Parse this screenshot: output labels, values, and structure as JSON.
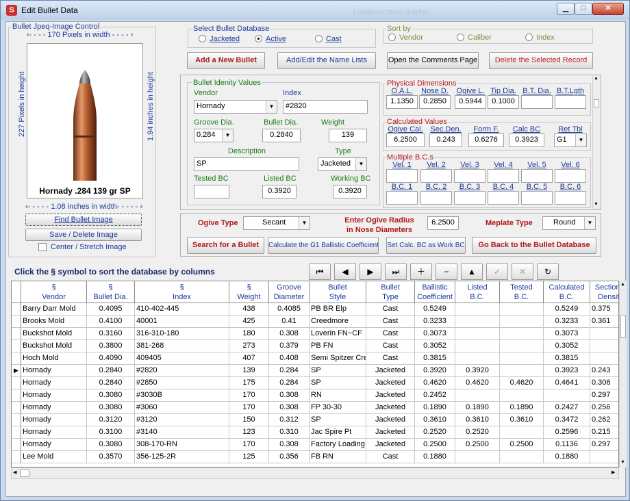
{
  "window": {
    "title": "Edit Bullet Data",
    "ghost_title": "Loadbenchtrial.graphic",
    "minimize": "▁",
    "maximize": "□",
    "close": "✕"
  },
  "image_control": {
    "group_label": "Bullet Jpeq-Image Control",
    "width_pixels": "‹- - - -  170  Pixels in width - - - - ›",
    "height_pixels": "227 Pixels in height",
    "height_inches": "1.94 inches in height",
    "width_inches": "‹- - - - - 1.08 inches in width- - - - - ›",
    "caption": "Hornady .284 139 gr SP",
    "find_button": "Find Bullet Image",
    "save_button": "Save / Delete Image",
    "center_label": "Center / Stretch Image"
  },
  "select_db": {
    "label": "Select Bullet Database",
    "options": [
      "Jacketed",
      "Active",
      "Cast"
    ],
    "selected": "Active"
  },
  "sort_by": {
    "label": "Sort by",
    "options": [
      "Vendor",
      "Caliber",
      "Index"
    ]
  },
  "buttons": {
    "add_new": "Add a New Bullet",
    "add_edit_names": "Add/Edit the Name Lists",
    "open_comments": "Open the Comments Page",
    "delete_record": "Delete the Selected Record",
    "search": "Search for a Bullet",
    "calc_g1": "Calculate the G1 Ballistic Coefficient",
    "set_calc_bc": "Set Calc. BC as Work BC",
    "go_back": "Go Back to the Bullet Database"
  },
  "identity": {
    "label": "Bullet Idenity Values",
    "vendor_label": "Vendor",
    "vendor": "Hornady",
    "index_label": "Index",
    "index": "#2820",
    "groove_label": "Groove Dia.",
    "groove": "0.284",
    "bullet_dia_label": "Bullet Dia.",
    "bullet_dia": "0.2840",
    "weight_label": "Weight",
    "weight": "139",
    "description_label": "Description",
    "description": "SP",
    "type_label": "Type",
    "type": "Jacketed",
    "tested_bc_label": "Tested BC",
    "tested_bc": "",
    "listed_bc_label": "Listed BC",
    "listed_bc": "0.3920",
    "working_bc_label": "Working BC",
    "working_bc": "0.3920"
  },
  "physical": {
    "label": "Physical Dimensions",
    "headers": [
      "O.A.L.",
      "Nose D.",
      "Ogive L.",
      "Tip Dia.",
      "B.T. Dia.",
      "B.T.Lgth"
    ],
    "values": [
      "1.1350",
      "0.2850",
      "0.5944",
      "0.1000",
      "",
      ""
    ]
  },
  "calculated": {
    "label": "Calculated Values",
    "headers": [
      "Ogive Cal.",
      "Sec.Den.",
      "Form F.",
      "Calc BC",
      "Ret Tbl"
    ],
    "values": [
      "6.2500",
      "0.243",
      "0.6276",
      "0.3923",
      "G1"
    ]
  },
  "multiple_bcs": {
    "label": "Multiple B.C.s",
    "vel_headers": [
      "Vel. 1",
      "Vel. 2",
      "Vel. 3",
      "Vel. 4",
      "Vel. 5",
      "Vel. 6"
    ],
    "bc_headers": [
      "B.C. 1",
      "B.C. 2",
      "B.C. 3",
      "B.C. 4",
      "B.C. 5",
      "B.C. 6"
    ]
  },
  "ogive": {
    "ogive_type_label": "Ogive Type",
    "ogive_type": "Secant",
    "radius_label1": "Enter Ogive Radius",
    "radius_label2": "in Nose Diameters",
    "radius": "6.2500",
    "meplate_label": "Meplate Type",
    "meplate": "Round"
  },
  "sort_hint": "Click the  §  symbol to sort the database by  columns",
  "navigator": [
    "⏮",
    "◀",
    "▶",
    "⏭",
    "＋",
    "−",
    "▲",
    "✓",
    "✕",
    "↻"
  ],
  "grid": {
    "columns": [
      {
        "sym": "§",
        "label": "Vendor"
      },
      {
        "sym": "§",
        "label": "Bullet Dia."
      },
      {
        "sym": "§",
        "label": "Index"
      },
      {
        "sym": "§",
        "label": "Weight"
      },
      {
        "sym": "Groove",
        "label": "Diameter"
      },
      {
        "sym": "Bullet",
        "label": "Style"
      },
      {
        "sym": "Bullet",
        "label": "Type"
      },
      {
        "sym": "Ballistic",
        "label": "Coefficient"
      },
      {
        "sym": "Listed",
        "label": "B.C."
      },
      {
        "sym": "Tested",
        "label": "B.C."
      },
      {
        "sym": "Calculated",
        "label": "B.C."
      },
      {
        "sym": "Sectional",
        "label": "Density"
      }
    ],
    "current_row": 5,
    "rows": [
      [
        "Barry Darr Mold",
        "0.4095",
        "410-402-445",
        "438",
        "0.4085",
        "PB BR Elp",
        "Cast",
        "0.5249",
        "",
        "",
        "0.5249",
        "0.375"
      ],
      [
        "Brooks Mold",
        "0.4100",
        "40001",
        "425",
        "0.41",
        "Creedmore",
        "Cast",
        "0.3233",
        "",
        "",
        "0.3233",
        "0.361"
      ],
      [
        "Buckshot Mold",
        "0.3160",
        "316-310-180",
        "180",
        "0.308",
        "Loverin FN~CF",
        "Cast",
        "0.3073",
        "",
        "",
        "0.3073",
        ""
      ],
      [
        "Buckshot Mold",
        "0.3800",
        "381-268",
        "273",
        "0.379",
        "PB FN",
        "Cast",
        "0.3052",
        "",
        "",
        "0.3052",
        ""
      ],
      [
        "Hoch Mold",
        "0.4090",
        "409405",
        "407",
        "0.408",
        "Semi Spitzer Cre",
        "Cast",
        "0.3815",
        "",
        "",
        "0.3815",
        ""
      ],
      [
        "Hornady",
        "0.2840",
        "#2820",
        "139",
        "0.284",
        "SP",
        "Jacketed",
        "0.3920",
        "0.3920",
        "",
        "0.3923",
        "0.243"
      ],
      [
        "Hornady",
        "0.2840",
        "#2850",
        "175",
        "0.284",
        "SP",
        "Jacketed",
        "0.4620",
        "0.4620",
        "0.4620",
        "0.4641",
        "0.306"
      ],
      [
        "Hornady",
        "0.3080",
        "#3030B",
        "170",
        "0.308",
        "RN",
        "Jacketed",
        "0.2452",
        "",
        "",
        "",
        "0.297"
      ],
      [
        "Hornady",
        "0.3080",
        "#3060",
        "170",
        "0.308",
        "FP 30-30",
        "Jacketed",
        "0.1890",
        "0.1890",
        "0.1890",
        "0.2427",
        "0.256"
      ],
      [
        "Hornady",
        "0.3120",
        "#3120",
        "150",
        "0.312",
        "SP",
        "Jacketed",
        "0.3610",
        "0.3610",
        "0.3610",
        "0.3472",
        "0.262"
      ],
      [
        "Hornady",
        "0.3100",
        "#3140",
        "123",
        "0.310",
        "Jac Spire Pt",
        "Jacketed",
        "0.2520",
        "0.2520",
        "",
        "0.2596",
        "0.215"
      ],
      [
        "Hornady",
        "0.3080",
        "308-170-RN",
        "170",
        "0.308",
        "Factory Loading",
        "Jacketed",
        "0.2500",
        "0.2500",
        "0.2500",
        "0.1136",
        "0.297"
      ],
      [
        "Lee Mold",
        "0.3570",
        "356-125-2R",
        "125",
        "0.356",
        "FB RN",
        "Cast",
        "0.1880",
        "",
        "",
        "0.1880",
        ""
      ]
    ]
  }
}
